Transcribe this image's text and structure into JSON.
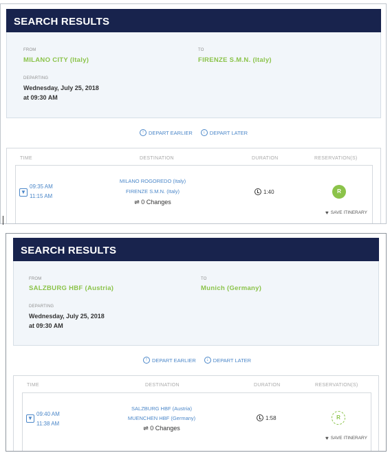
{
  "panels": [
    {
      "title": "SEARCH RESULTS",
      "from_label": "FROM",
      "from_city": "MILANO CITY (Italy)",
      "to_label": "TO",
      "to_city": "FIRENZE S.M.N. (Italy)",
      "departing_label": "DEPARTING",
      "departing_date": "Wednesday, July 25, 2018",
      "departing_time": "at 09:30 AM",
      "earlier_label": "DEPART EARLIER",
      "later_label": "DEPART LATER",
      "columns": {
        "time": "TIME",
        "destination": "DESTINATION",
        "duration": "DURATION",
        "reservation": "RESERVATION(S)"
      },
      "result": {
        "depart_time": "09:35 AM",
        "arrive_time": "11:15 AM",
        "origin": "MILANO ROGOREDO (Italy)",
        "destination": "FIRENZE S.M.N. (Italy)",
        "changes": "0 Changes",
        "duration": "1:40",
        "reservation_badge": "R",
        "save_label": "SAVE ITINERARY"
      }
    },
    {
      "title": "SEARCH RESULTS",
      "from_label": "FROM",
      "from_city": "SALZBURG HBF (Austria)",
      "to_label": "TO",
      "to_city": "Munich (Germany)",
      "departing_label": "DEPARTING",
      "departing_date": "Wednesday, July 25, 2018",
      "departing_time": "at 09:30 AM",
      "earlier_label": "DEPART EARLIER",
      "later_label": "DEPART LATER",
      "columns": {
        "time": "TIME",
        "destination": "DESTINATION",
        "duration": "DURATION",
        "reservation": "RESERVATION(S)"
      },
      "result": {
        "depart_time": "09:40 AM",
        "arrive_time": "11:38 AM",
        "origin": "SALZBURG HBF (Austria)",
        "destination": "MUENCHEN HBF (Germany)",
        "changes": "0 Changes",
        "duration": "1:58",
        "reservation_badge": "R",
        "save_label": "SAVE ITINERARY"
      }
    }
  ],
  "icons": {
    "earlier": "arrow-up-circle-icon",
    "later": "arrow-down-circle-icon",
    "expand": "caret-down-icon",
    "changes": "swap-arrows-icon",
    "clock": "clock-icon",
    "save": "heart-icon"
  },
  "colors": {
    "header": "#18234d",
    "accent": "#8bc34a",
    "link": "#4a86c8"
  }
}
